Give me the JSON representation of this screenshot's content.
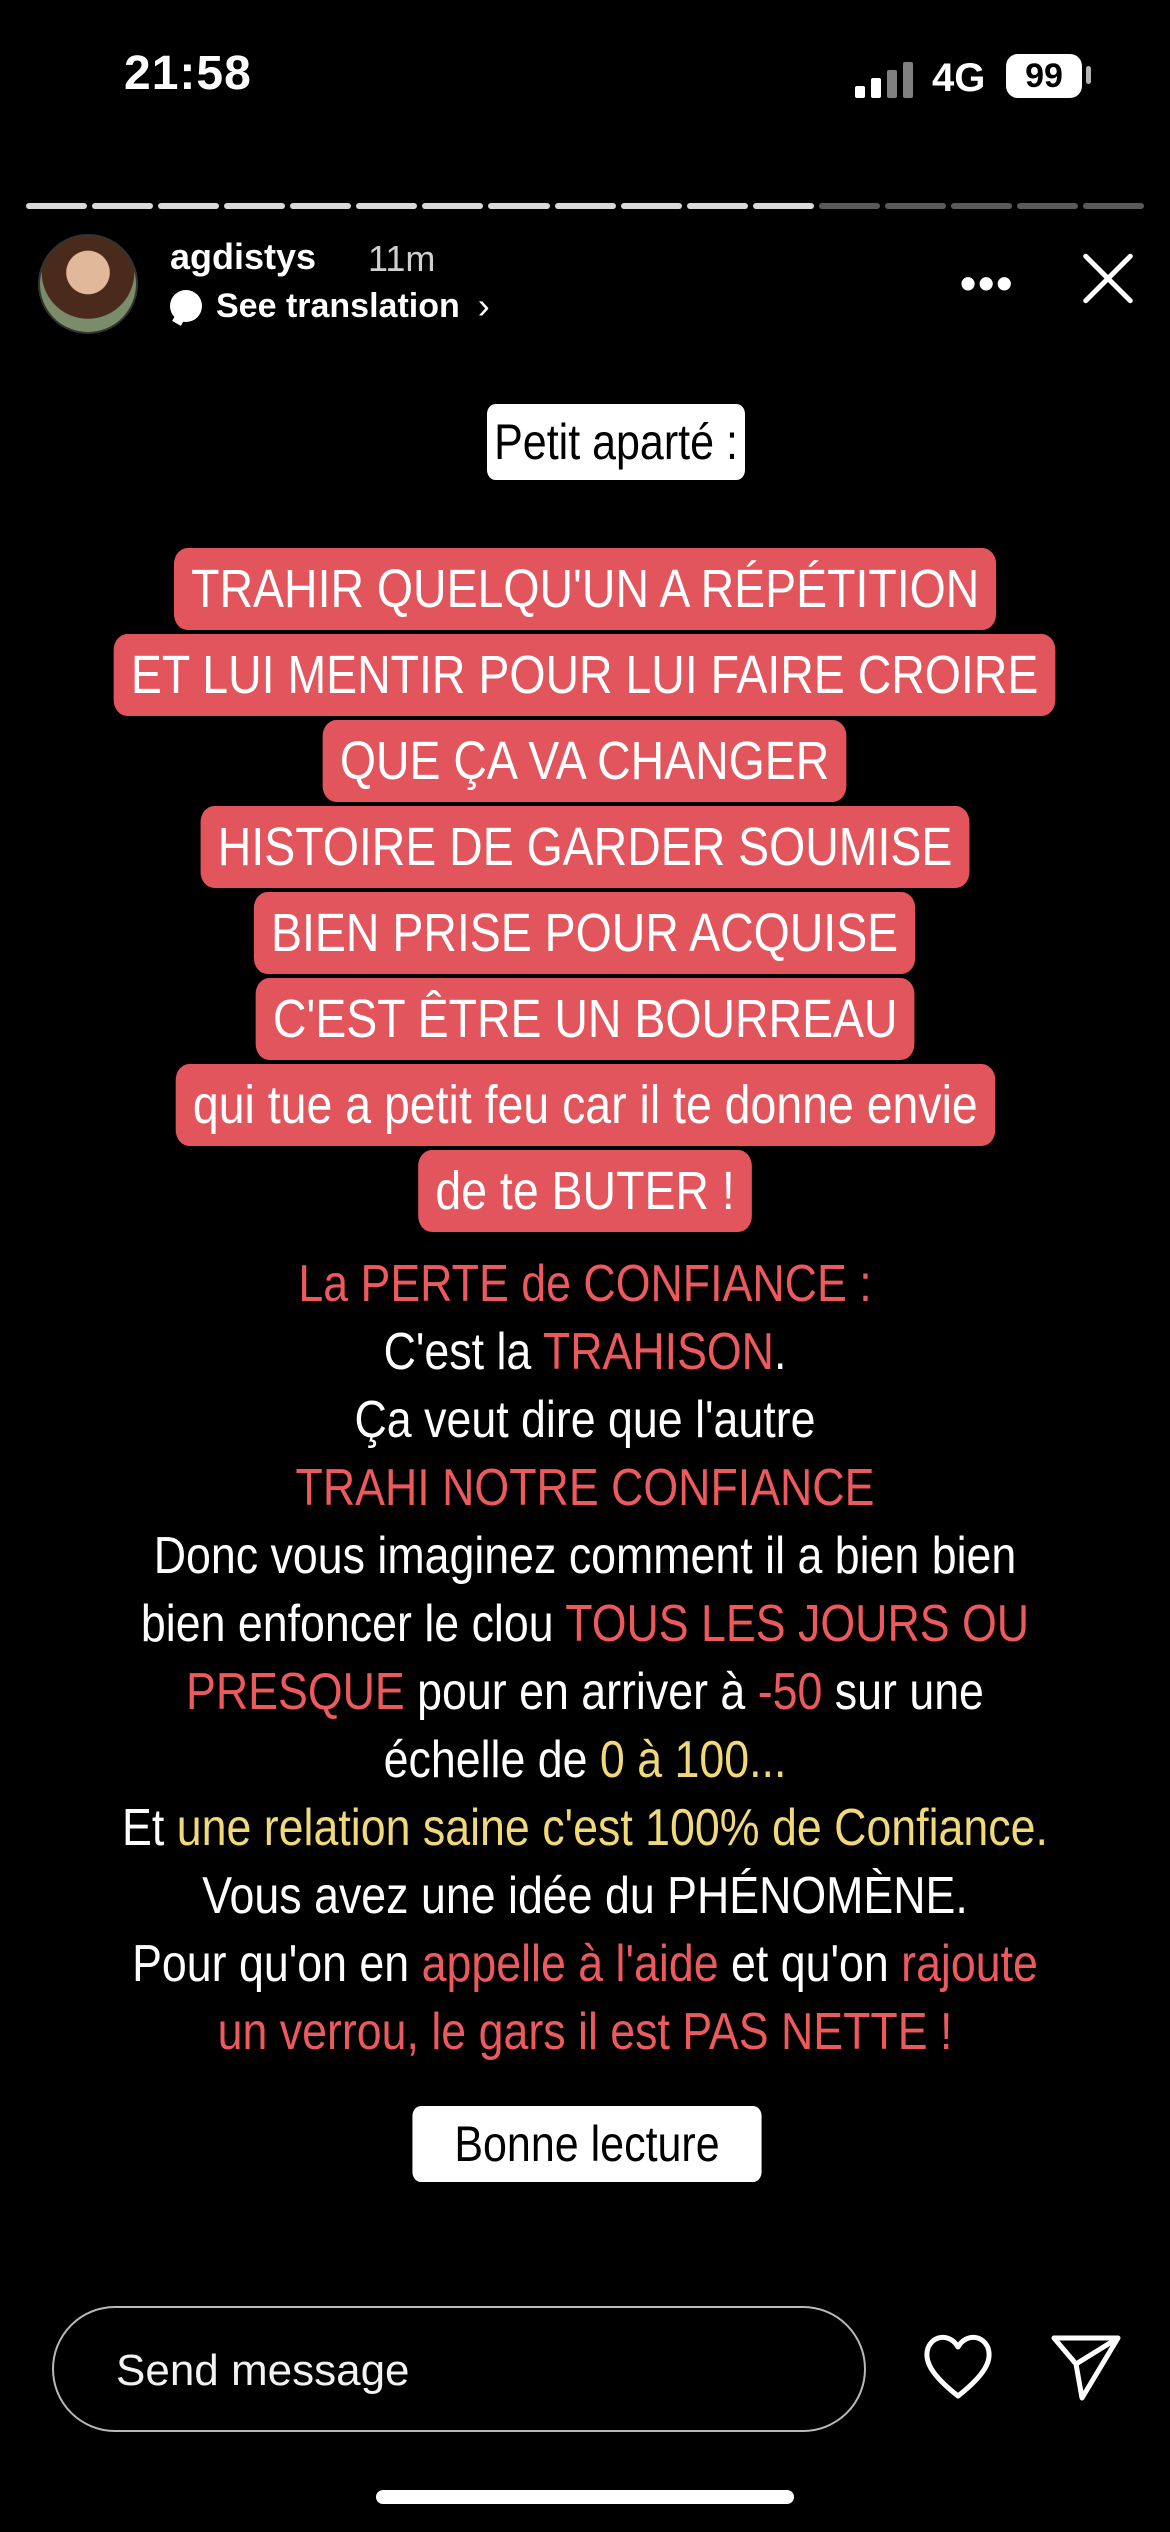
{
  "status": {
    "time": "21:58",
    "network": "4G",
    "battery": "99"
  },
  "story": {
    "username": "agdistys",
    "time_ago": "11m",
    "see_translation": "See translation",
    "progress": {
      "total": 17,
      "current": 12
    },
    "title": "Petit aparté :",
    "red_lines": [
      "TRAHIR QUELQU'UN A RÉPÉTITION",
      "ET LUI MENTIR POUR LUI FAIRE CROIRE",
      "QUE ÇA VA CHANGER",
      "HISTOIRE DE GARDER SOUMISE",
      "BIEN PRISE POUR ACQUISE",
      "C'EST ÊTRE UN BOURREAU",
      "qui tue a petit feu car il te donne envie",
      "de te BUTER !"
    ],
    "body": {
      "l1": "La PERTE de CONFIANCE :",
      "l2_a": "C'est la ",
      "l2_b": "TRAHISON",
      "l2_c": ".",
      "l3": "Ça veut dire que l'autre",
      "l4": "TRAHI NOTRE CONFIANCE",
      "l5": "Donc vous imaginez comment il a bien bien",
      "l6_a": "bien enfoncer le clou ",
      "l6_b": "TOUS LES JOURS OU",
      "l7_a": "PRESQUE",
      "l7_b": " pour en arriver à ",
      "l7_c": "-50",
      "l7_d": " sur une",
      "l8_a": "échelle de ",
      "l8_b": "0 à 100...",
      "l9_a": "Et ",
      "l9_b": "une relation saine c'est 100% de Confiance.",
      "l10": "Vous avez une idée du PHÉNOMÈNE.",
      "l11_a": "Pour qu'on en ",
      "l11_b": "appelle à l'aide",
      "l11_c": " et qu'on ",
      "l11_d": "rajoute",
      "l12": "un verrou, le gars il est PAS NETTE !"
    },
    "cta": "Bonne lecture >>>"
  },
  "footer": {
    "message_placeholder": "Send message"
  },
  "colors": {
    "red_highlight": "#e3555c",
    "red_text": "#ec5a5e",
    "yellow_text": "#f1d97a"
  }
}
